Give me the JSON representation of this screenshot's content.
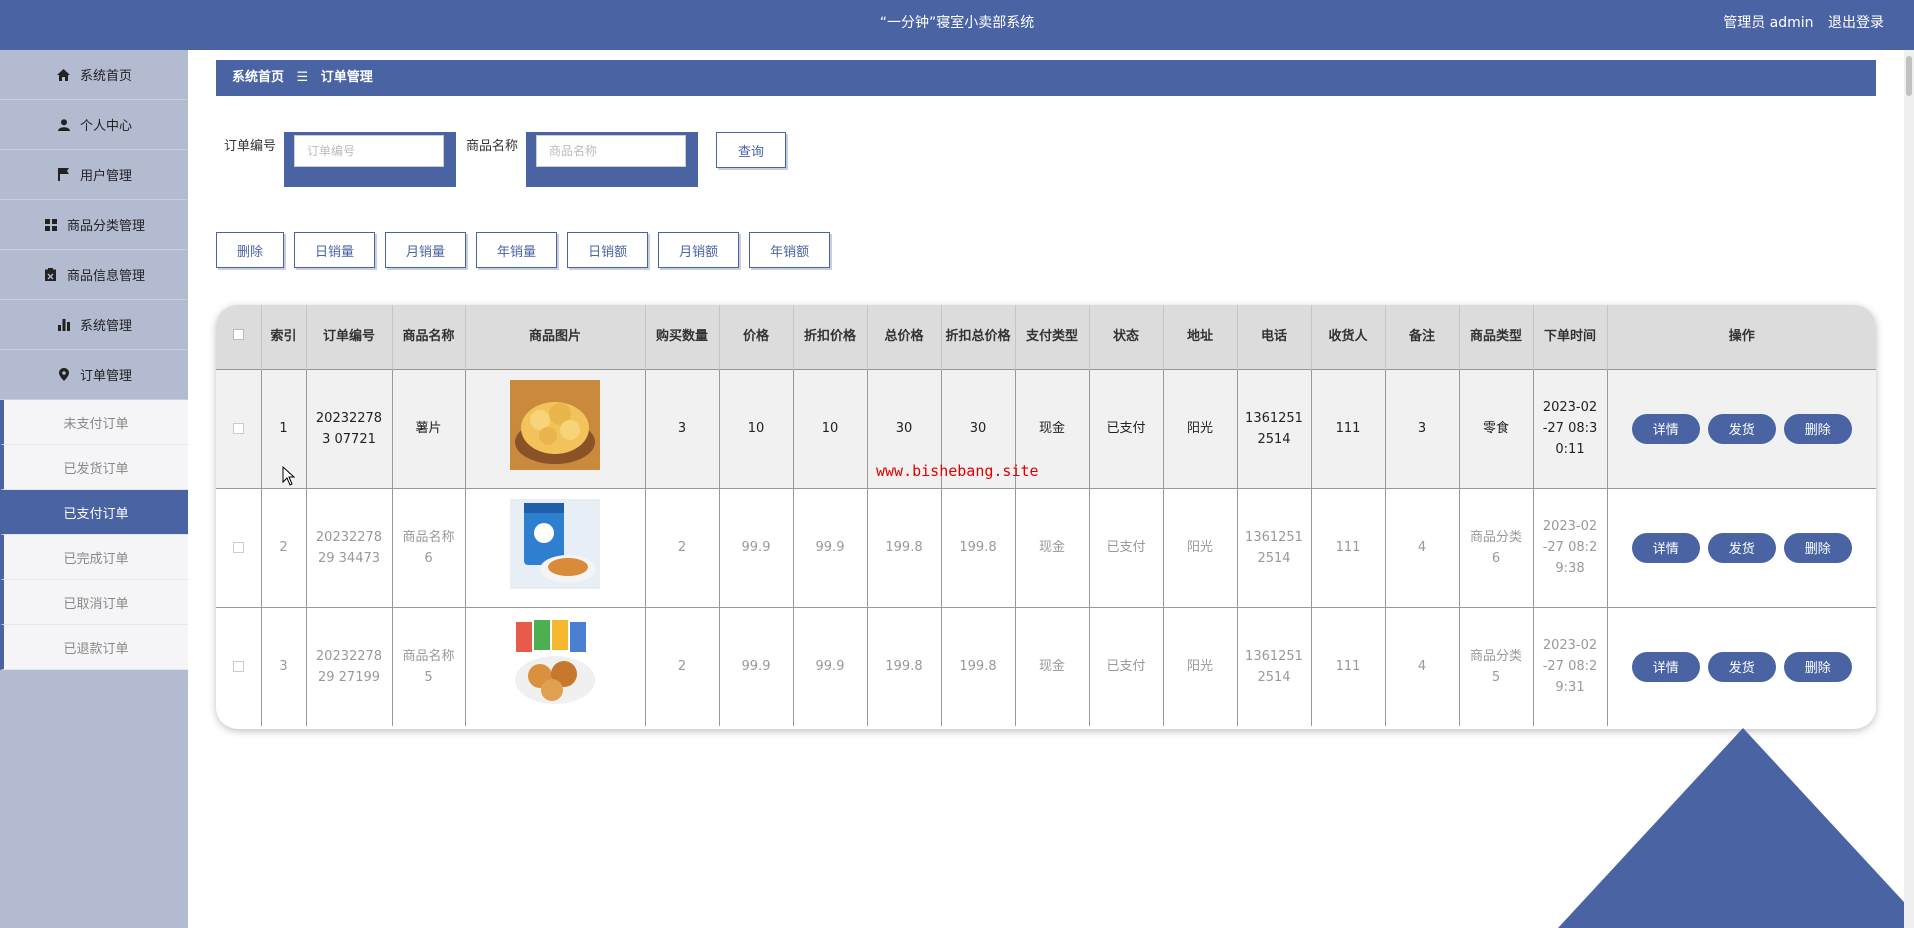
{
  "header": {
    "title": "“一分钟”寝室小卖部系统",
    "user": "管理员 admin",
    "logout": "退出登录"
  },
  "sidebar": {
    "items": [
      {
        "label": "系统首页",
        "icon": "home-icon"
      },
      {
        "label": "个人中心",
        "icon": "user-icon"
      },
      {
        "label": "用户管理",
        "icon": "flag-icon"
      },
      {
        "label": "商品分类管理",
        "icon": "grid-icon"
      },
      {
        "label": "商品信息管理",
        "icon": "clipboard-icon"
      },
      {
        "label": "系统管理",
        "icon": "bar-chart-icon"
      },
      {
        "label": "订单管理",
        "icon": "location-pin-icon"
      }
    ],
    "sub_items": [
      {
        "label": "未支付订单",
        "active": false
      },
      {
        "label": "已发货订单",
        "active": false
      },
      {
        "label": "已支付订单",
        "active": true
      },
      {
        "label": "已完成订单",
        "active": false
      },
      {
        "label": "已取消订单",
        "active": false
      },
      {
        "label": "已退款订单",
        "active": false
      }
    ]
  },
  "breadcrumb": {
    "home": "系统首页",
    "sep": "☰",
    "current": "订单管理"
  },
  "search": {
    "order_label": "订单编号",
    "order_placeholder": "订单编号",
    "product_label": "商品名称",
    "product_placeholder": "商品名称",
    "query": "查询"
  },
  "toolbar": [
    "删除",
    "日销量",
    "月销量",
    "年销量",
    "日销额",
    "月销额",
    "年销额"
  ],
  "table": {
    "columns": [
      "索引",
      "订单编号",
      "商品名称",
      "商品图片",
      "购买数量",
      "价格",
      "折扣价格",
      "总价格",
      "折扣总价格",
      "支付类型",
      "状态",
      "地址",
      "电话",
      "收货人",
      "备注",
      "商品类型",
      "下单时间",
      "操作"
    ],
    "rows": [
      {
        "index": "1",
        "order_no": "202322783 07721",
        "name": "薯片",
        "image": "potato-chips-bowl",
        "qty": "3",
        "price": "10",
        "discount_price": "10",
        "total": "30",
        "discount_total": "30",
        "pay_type": "现金",
        "status": "已支付",
        "address": "阳光",
        "phone": "1361251 2514",
        "receiver": "111",
        "remark": "3",
        "category": "零食",
        "time": "2023-02 -27 08:3 0:11"
      },
      {
        "index": "2",
        "order_no": "2023227829 34473",
        "name": "商品名称 6",
        "image": "snack-bag-blue",
        "qty": "2",
        "price": "99.9",
        "discount_price": "99.9",
        "total": "199.8",
        "discount_total": "199.8",
        "pay_type": "现金",
        "status": "已支付",
        "address": "阳光",
        "phone": "1361251 2514",
        "receiver": "111",
        "remark": "4",
        "category": "商品分类 6",
        "time": "2023-02 -27 08:2 9:38"
      },
      {
        "index": "3",
        "order_no": "2023227829 27199",
        "name": "商品名称 5",
        "image": "cookies-plate",
        "qty": "2",
        "price": "99.9",
        "discount_price": "99.9",
        "total": "199.8",
        "discount_total": "199.8",
        "pay_type": "现金",
        "status": "已支付",
        "address": "阳光",
        "phone": "1361251 2514",
        "receiver": "111",
        "remark": "4",
        "category": "商品分类 5",
        "time": "2023-02 -27 08:2 9:31"
      }
    ],
    "ops": [
      "详情",
      "发货",
      "删除"
    ]
  },
  "watermark": "www.bishebang.site",
  "colors": {
    "primary": "#4a63a3",
    "sidebar": "#b2bbd0",
    "watermark": "#e00000"
  }
}
